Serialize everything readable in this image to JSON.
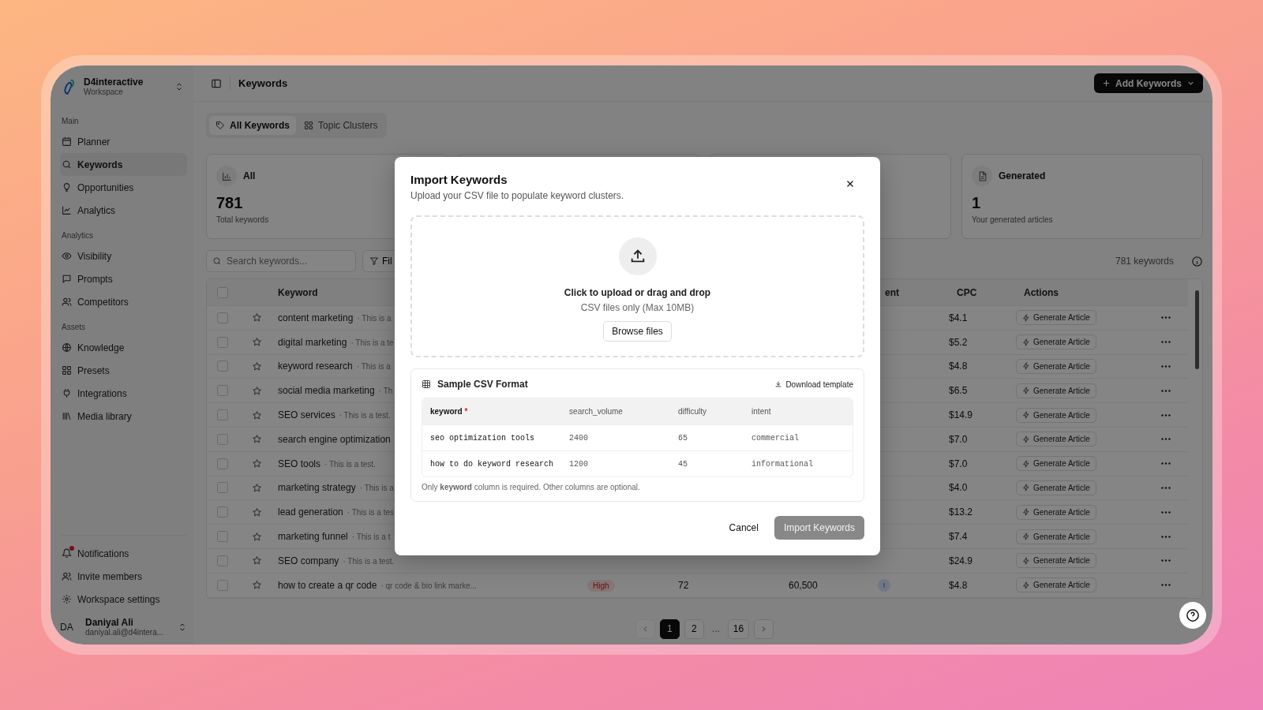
{
  "workspace": {
    "name": "D4interactive",
    "subtitle": "Workspace"
  },
  "sidebar": {
    "sections": [
      {
        "label": "Main",
        "items": [
          {
            "label": "Planner",
            "selected": false
          },
          {
            "label": "Keywords",
            "selected": true
          },
          {
            "label": "Opportunities",
            "selected": false
          },
          {
            "label": "Analytics",
            "selected": false
          }
        ]
      },
      {
        "label": "Analytics",
        "items": [
          {
            "label": "Visibility",
            "selected": false
          },
          {
            "label": "Prompts",
            "selected": false
          },
          {
            "label": "Competitors",
            "selected": false
          }
        ]
      },
      {
        "label": "Assets",
        "items": [
          {
            "label": "Knowledge",
            "selected": false
          },
          {
            "label": "Presets",
            "selected": false
          },
          {
            "label": "Integrations",
            "selected": false
          },
          {
            "label": "Media library",
            "selected": false
          }
        ]
      }
    ],
    "footer": [
      {
        "label": "Notifications",
        "unread": true
      },
      {
        "label": "Invite members",
        "unread": false
      },
      {
        "label": "Workspace settings",
        "unread": false
      }
    ],
    "user": {
      "initials": "DA",
      "name": "Daniyal Ali",
      "email": "daniyal.ali@d4intera..."
    }
  },
  "header": {
    "title": "Keywords",
    "add_button": "Add Keywords"
  },
  "tabs": [
    {
      "label": "All Keywords",
      "selected": true
    },
    {
      "label": "Topic Clusters",
      "selected": false
    }
  ],
  "cards": [
    {
      "kind": "stat",
      "label": "All",
      "value": "781",
      "caption": "Total keywords"
    },
    {
      "kind": "covered"
    },
    {
      "kind": "covered"
    },
    {
      "kind": "stat",
      "label": "Generated",
      "value": "1",
      "caption": "Your generated articles"
    }
  ],
  "toolbar": {
    "search_placeholder": "Search keywords...",
    "filter": "Fil",
    "count": "781 keywords"
  },
  "table": {
    "all_checked": false,
    "columns": [
      {
        "label": "Keyword"
      },
      {
        "label": "ent"
      },
      {
        "label": "CPC"
      },
      {
        "label": "Actions"
      }
    ],
    "rows": [
      {
        "checked": false,
        "keyword": "content marketing",
        "description": "· This is a",
        "cpc": "$4.1",
        "action": "Generate Article"
      },
      {
        "checked": false,
        "keyword": "digital marketing",
        "description": "· This is a te",
        "cpc": "$5.2",
        "action": "Generate Article"
      },
      {
        "checked": false,
        "keyword": "keyword research",
        "description": "· This is a",
        "cpc": "$4.8",
        "action": "Generate Article"
      },
      {
        "checked": false,
        "keyword": "social media marketing",
        "description": "· Th",
        "cpc": "$6.5",
        "action": "Generate Article"
      },
      {
        "checked": false,
        "keyword": "SEO services",
        "description": "· This is a test.",
        "cpc": "$14.9",
        "action": "Generate Article"
      },
      {
        "checked": false,
        "keyword": "search engine optimization",
        "cpc": "$7.0",
        "action": "Generate Article"
      },
      {
        "checked": false,
        "keyword": "SEO tools",
        "description": "· This is a test.",
        "cpc": "$7.0",
        "action": "Generate Article"
      },
      {
        "checked": false,
        "keyword": "marketing strategy",
        "description": "· This is a",
        "cpc": "$4.0",
        "action": "Generate Article"
      },
      {
        "checked": false,
        "keyword": "lead generation",
        "description": "· This is a tes",
        "cpc": "$13.2",
        "action": "Generate Article"
      },
      {
        "checked": false,
        "keyword": "marketing funnel",
        "description": "· This is a t",
        "cpc": "$7.4",
        "action": "Generate Article"
      },
      {
        "checked": false,
        "keyword": "SEO company",
        "description": "· This is a test.",
        "cpc": "$24.9",
        "action": "Generate Article"
      },
      {
        "checked": false,
        "keyword": "how to create a qr code",
        "description": "· qr code & bio link marke...",
        "difficulty": "High",
        "kd": "72",
        "volume": "60,500",
        "intent": "I",
        "cpc": "$4.8",
        "action": "Generate Article"
      }
    ]
  },
  "pagination": [
    {
      "kind": "prev"
    },
    {
      "kind": "page",
      "label": "1",
      "selected": true
    },
    {
      "kind": "page",
      "label": "2",
      "selected": false
    },
    {
      "kind": "ellipsis",
      "label": "..."
    },
    {
      "kind": "page",
      "label": "16",
      "selected": false
    },
    {
      "kind": "next"
    }
  ],
  "dialog": {
    "title": "Import Keywords",
    "subtitle": "Upload your CSV file to populate keyword clusters.",
    "dropzone": {
      "title": "Click to upload or drag and drop",
      "hint": "CSV files only (Max 10MB)",
      "button": "Browse files"
    },
    "sample": {
      "title": "Sample CSV Format",
      "download": "Download template",
      "columns": [
        {
          "label": "keyword",
          "required_mark": "*"
        },
        {
          "label": "search_volume"
        },
        {
          "label": "difficulty"
        },
        {
          "label": "intent"
        }
      ],
      "rows": [
        [
          "seo optimization tools",
          "2400",
          "65",
          "commercial"
        ],
        [
          "how to do keyword research",
          "1200",
          "45",
          "informational"
        ]
      ],
      "note": "Only **keyword** column is required. Other columns are optional."
    },
    "cancel": "Cancel",
    "submit": {
      "label": "Import Keywords",
      "disabled": true
    }
  }
}
